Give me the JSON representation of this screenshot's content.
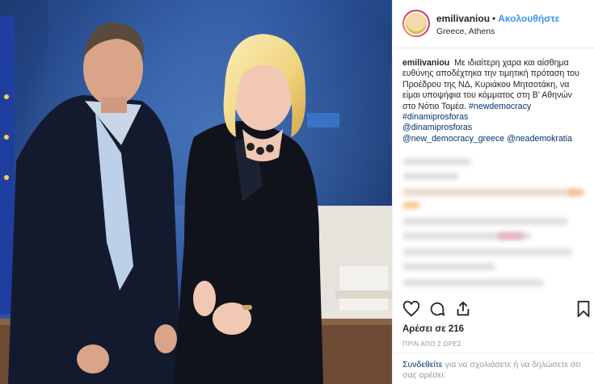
{
  "post": {
    "username": "emilivaniou",
    "separator": "•",
    "follow_label": "Ακολουθήστε",
    "location": "Greece, Athens",
    "caption_username": "emilivaniou",
    "caption_text": "Με ιδιαίτερη χαρα και αίσθημα ευθύνης αποδέχτηκα την τιμητική πρόταση του Προέδρου της ΝΔ, Κυριάκου Μητσοτάκη, να είμαι υποψήφια του κόμματος στη Β' Αθηνών στο Νότιο Τομέα.",
    "hashtags": {
      "h1": "#newdemocracy",
      "h2": "#dinamiprosforas",
      "h3": "@dinamiprosforas",
      "h4": "@new_democracy_greece",
      "h5": "@neademokratia"
    },
    "likes_text": "Αρέσει σε 216",
    "time_text": "ΠΡΙΝ ΑΠΟ 2 ΩΡΕΣ",
    "comment": {
      "login_link": "Συνδεθείτε",
      "rest_text": " για να σχολιάσετε ή να δηλώσετε ότι σας αρέσει."
    }
  },
  "icons": {
    "like": "heart-icon",
    "comment": "comment-bubble-icon",
    "share": "share-icon",
    "save": "bookmark-icon"
  },
  "colors": {
    "link": "#003569",
    "follow": "#3897f0",
    "text": "#262626",
    "muted": "#999999",
    "border": "#efefef"
  }
}
